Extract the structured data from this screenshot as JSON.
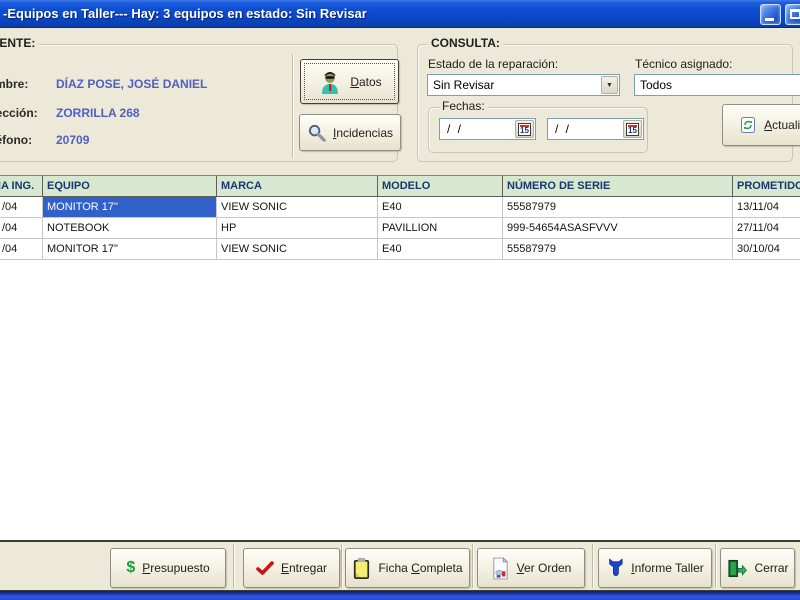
{
  "window": {
    "title": "-Equipos en Taller--- Hay: 3 equipos en estado: Sin Revisar"
  },
  "cliente": {
    "group_label": "CLIENTE:",
    "fields": [
      {
        "label": "Nombre:",
        "value": "DÍAZ POSE, JOSÉ DANIEL"
      },
      {
        "label": "Dirección:",
        "value": "ZORRILLA 268"
      },
      {
        "label": "Teléfono:",
        "value": "20709"
      }
    ],
    "datos_button": {
      "pre": "",
      "u": "D",
      "post": "atos"
    },
    "incidencias_button": {
      "pre": "",
      "u": "I",
      "post": "ncidencias"
    }
  },
  "consulta": {
    "group_label": "CONSULTA:",
    "estado": {
      "label": "Estado de la reparación:",
      "value": "Sin Revisar"
    },
    "tecnico": {
      "label": "Técnico asignado:",
      "value": "Todos"
    },
    "fechas": {
      "label": "Fechas:",
      "desde": "/ /",
      "hasta": "/ /"
    },
    "actualizar_button": {
      "pre": "",
      "u": "A",
      "post": "ctualizar"
    }
  },
  "grid": {
    "columns": [
      "FECHA ING.",
      "EQUIPO",
      "MARCA",
      "MODELO",
      "NÚMERO DE SERIE",
      "PROMETIDO"
    ],
    "rows": [
      [
        "/04",
        "MONITOR 17\"",
        "VIEW SONIC",
        "E40",
        "55587979",
        "13/11/04"
      ],
      [
        "/04",
        "NOTEBOOK",
        "HP",
        "PAVILLION",
        "999-54654ASASFVVV",
        "27/11/04"
      ],
      [
        "/04",
        "MONITOR 17\"",
        "VIEW SONIC",
        "E40",
        "55587979",
        "30/10/04"
      ]
    ],
    "selection": {
      "row": 0,
      "column": 1
    }
  },
  "footer": {
    "buttons": [
      {
        "pre": "",
        "u": "P",
        "post": "resupuesto"
      },
      {
        "pre": "",
        "u": "E",
        "post": "ntregar"
      },
      {
        "pre": "Ficha ",
        "u": "C",
        "post": "ompleta"
      },
      {
        "pre": "",
        "u": "V",
        "post": "er Orden"
      },
      {
        "pre": "",
        "u": "I",
        "post": "nforme Taller"
      },
      {
        "pre": "Cerrar",
        "u": "",
        "post": ""
      }
    ]
  },
  "icons": {
    "dropdown_arrow": "▼",
    "calendar_day": "15",
    "dollar": "$",
    "minimize": "underscore-bar",
    "maximize": "square-outline",
    "datos": "person-with-sunglasses",
    "incidencias": "magnifying-glass",
    "actualizar": "refresh-page",
    "entregar": "red-check-mark",
    "ficha_completa": "yellow-clipboard",
    "ver_orden": "document",
    "informe_taller": "blue-wrench",
    "cerrar": "exit-door-arrow"
  },
  "colors": {
    "titlebar": "#0f4fd2",
    "background": "#EDE9D8",
    "grid_header_bg": "#D7E7D0",
    "grid_header_text": "#16386E",
    "selection_bg": "#3161C8",
    "client_value_text": "#4F5FC5",
    "bottom_strip": "#2B55D4"
  }
}
